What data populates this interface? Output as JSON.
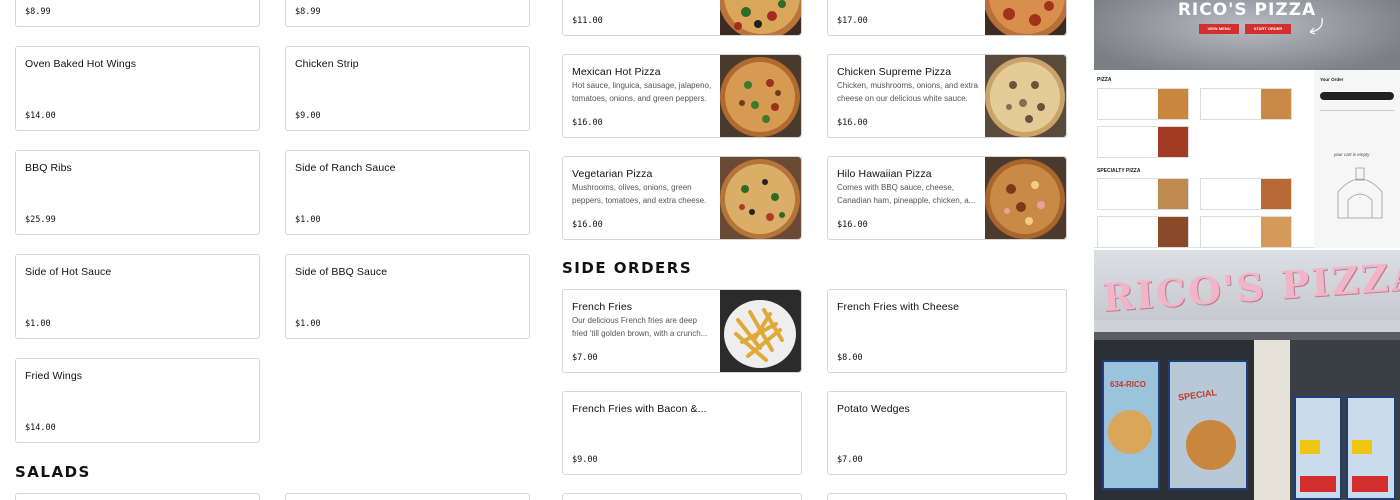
{
  "left_menu": {
    "items": [
      {
        "name": "",
        "price": "$8.99"
      },
      {
        "name": "",
        "price": "$8.99"
      },
      {
        "name": "Oven Baked Hot Wings",
        "price": "$14.00"
      },
      {
        "name": "Chicken Strip",
        "price": "$9.00"
      },
      {
        "name": "BBQ Ribs",
        "price": "$25.99"
      },
      {
        "name": "Side of Ranch Sauce",
        "price": "$1.00"
      },
      {
        "name": "Side of Hot Sauce",
        "price": "$1.00"
      },
      {
        "name": "Side of BBQ Sauce",
        "price": "$1.00"
      },
      {
        "name": "Fried Wings",
        "price": "$14.00"
      }
    ]
  },
  "pizza_menu": {
    "items": [
      {
        "name": "",
        "desc": "",
        "price": "$11.00"
      },
      {
        "name": "",
        "desc": "",
        "price": "$17.00"
      },
      {
        "name": "Mexican Hot Pizza",
        "desc": "Hot sauce, linguica, sausage, jalapeno, tomatoes, onions, and green peppers.",
        "price": "$16.00"
      },
      {
        "name": "Chicken Supreme Pizza",
        "desc": "Chicken, mushrooms, onions, and extra cheese on our delicious white sauce.",
        "price": "$16.00"
      },
      {
        "name": "Vegetarian Pizza",
        "desc": "Mushrooms, olives, onions, green peppers, tomatoes, and extra cheese.",
        "price": "$16.00"
      },
      {
        "name": "Hilo Hawaiian Pizza",
        "desc": "Comes with BBQ sauce, cheese, Canadian ham, pineapple, chicken, a...",
        "price": "$16.00"
      }
    ]
  },
  "side_orders": {
    "heading": "SIDE ORDERS",
    "items": [
      {
        "name": "French Fries",
        "desc": "Our delicious French fries are deep fried 'till golden brown, with a crunch...",
        "price": "$7.00"
      },
      {
        "name": "French Fries with Cheese",
        "desc": "",
        "price": "$8.00"
      },
      {
        "name": "French Fries with Bacon &...",
        "desc": "",
        "price": "$9.00"
      },
      {
        "name": "Potato Wedges",
        "desc": "",
        "price": "$7.00"
      }
    ]
  },
  "salads": {
    "heading": "SALADS"
  },
  "promo": {
    "banner_title": "RICO'S PIZZA",
    "view_menu": "VIEW MENU",
    "start_order": "START ORDER",
    "preview_heading": "PIZZA",
    "preview_specialty": "SPECIALTY PIZZA",
    "preview_order": "Your Order",
    "preview_empty": "your cart is empty",
    "storefront_sign": "RICO'S PIZZA",
    "storefront_phone": "634-RICO",
    "storefront_special": "SPECIAL"
  },
  "colors": {
    "accent_red": "#d32f2f",
    "sign_pink": "#f2b5c8",
    "wall_gray": "#cfd2d6"
  }
}
